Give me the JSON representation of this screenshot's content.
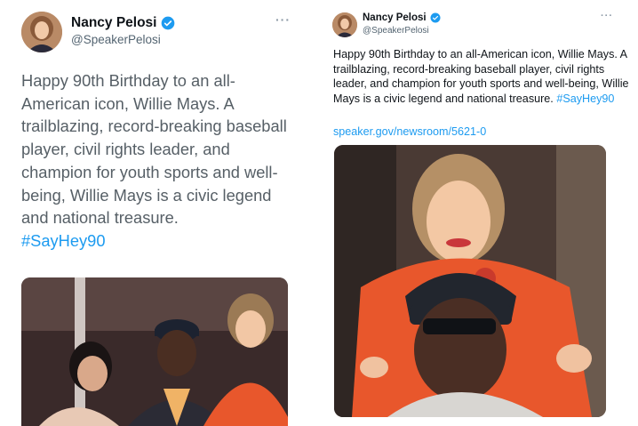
{
  "left_tweet": {
    "author_name": "Nancy Pelosi",
    "author_handle": "@SpeakerPelosi",
    "more_label": "···",
    "text": "Happy 90th Birthday to an all-American icon, Willie Mays. A trailblazing, record-breaking baseball player, civil rights leader, and champion for youth sports and well-being, Willie Mays is a civic legend and national treasure.",
    "hashtag": "#SayHey90",
    "verified_icon": "verified-badge-icon",
    "photo_icon": "photo"
  },
  "right_tweet": {
    "author_name": "Nancy Pelosi",
    "author_handle": "@SpeakerPelosi",
    "more_label": "···",
    "text": "Happy 90th Birthday to an all-American icon, Willie Mays. A trailblazing, record-breaking baseball player, civil rights leader, and champion for youth sports and well-being, Willie Mays is a civic legend and national treasure.",
    "hashtag": "#SayHey90",
    "link_text": "speaker.gov/newsroom/5621-0",
    "verified_icon": "verified-badge-icon",
    "photo_icon": "photo"
  },
  "colors": {
    "accent": "#1d9bf0",
    "secondary_text": "#536471",
    "left_body_text": "#565f66",
    "primary_text": "#0f1419",
    "jacket_orange": "#e8572c"
  }
}
